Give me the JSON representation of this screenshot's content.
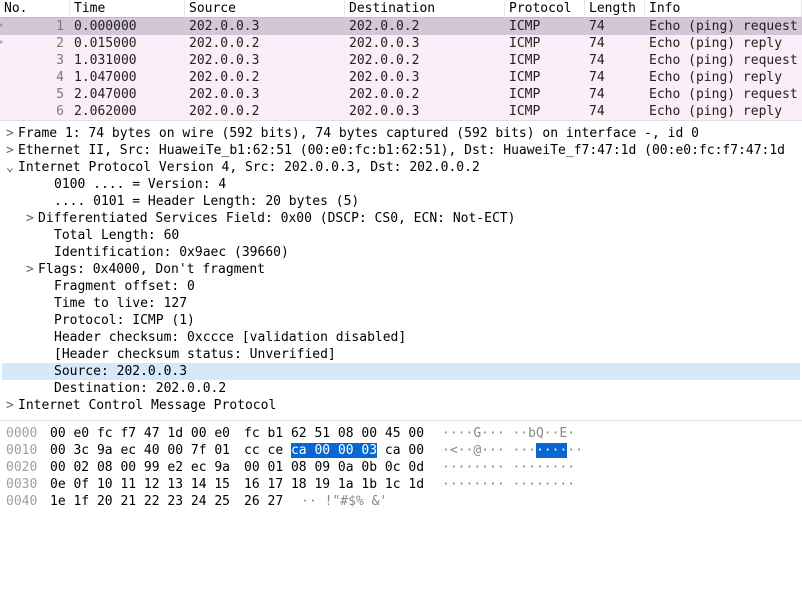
{
  "columns": [
    "No.",
    "Time",
    "Source",
    "Destination",
    "Protocol",
    "Length",
    "Info"
  ],
  "packets": [
    {
      "no": "1",
      "time": "0.000000",
      "src": "202.0.0.3",
      "dst": "202.0.0.2",
      "proto": "ICMP",
      "len": "74",
      "info": "Echo (ping) request",
      "sel": true,
      "mark": true
    },
    {
      "no": "2",
      "time": "0.015000",
      "src": "202.0.0.2",
      "dst": "202.0.0.3",
      "proto": "ICMP",
      "len": "74",
      "info": "Echo (ping) reply",
      "mark": true
    },
    {
      "no": "3",
      "time": "1.031000",
      "src": "202.0.0.3",
      "dst": "202.0.0.2",
      "proto": "ICMP",
      "len": "74",
      "info": "Echo (ping) request"
    },
    {
      "no": "4",
      "time": "1.047000",
      "src": "202.0.0.2",
      "dst": "202.0.0.3",
      "proto": "ICMP",
      "len": "74",
      "info": "Echo (ping) reply"
    },
    {
      "no": "5",
      "time": "2.047000",
      "src": "202.0.0.3",
      "dst": "202.0.0.2",
      "proto": "ICMP",
      "len": "74",
      "info": "Echo (ping) request"
    },
    {
      "no": "6",
      "time": "2.062000",
      "src": "202.0.0.2",
      "dst": "202.0.0.3",
      "proto": "ICMP",
      "len": "74",
      "info": "Echo (ping) reply"
    }
  ],
  "details": [
    {
      "lvl": 0,
      "caret": ">",
      "txt": "Frame 1: 74 bytes on wire (592 bits), 74 bytes captured (592 bits) on interface -, id 0"
    },
    {
      "lvl": 0,
      "caret": ">",
      "txt": "Ethernet II, Src: HuaweiTe_b1:62:51 (00:e0:fc:b1:62:51), Dst: HuaweiTe_f7:47:1d (00:e0:fc:f7:47:1d"
    },
    {
      "lvl": 0,
      "caret": "v",
      "txt": "Internet Protocol Version 4, Src: 202.0.0.3, Dst: 202.0.0.2"
    },
    {
      "lvl": 2,
      "caret": "",
      "txt": "0100 .... = Version: 4"
    },
    {
      "lvl": 2,
      "caret": "",
      "txt": ".... 0101 = Header Length: 20 bytes (5)"
    },
    {
      "lvl": 1,
      "caret": ">",
      "txt": "Differentiated Services Field: 0x00 (DSCP: CS0, ECN: Not-ECT)"
    },
    {
      "lvl": 2,
      "caret": "",
      "txt": "Total Length: 60"
    },
    {
      "lvl": 2,
      "caret": "",
      "txt": "Identification: 0x9aec (39660)"
    },
    {
      "lvl": 1,
      "caret": ">",
      "txt": "Flags: 0x4000, Don't fragment"
    },
    {
      "lvl": 2,
      "caret": "",
      "txt": "Fragment offset: 0"
    },
    {
      "lvl": 2,
      "caret": "",
      "txt": "Time to live: 127"
    },
    {
      "lvl": 2,
      "caret": "",
      "txt": "Protocol: ICMP (1)"
    },
    {
      "lvl": 2,
      "caret": "",
      "txt": "Header checksum: 0xccce [validation disabled]"
    },
    {
      "lvl": 2,
      "caret": "",
      "txt": "[Header checksum status: Unverified]"
    },
    {
      "lvl": 2,
      "caret": "",
      "txt": "Source: 202.0.0.3",
      "hl": true
    },
    {
      "lvl": 2,
      "caret": "",
      "txt": "Destination: 202.0.0.2"
    },
    {
      "lvl": 0,
      "caret": ">",
      "txt": "Internet Control Message Protocol"
    }
  ],
  "hex": [
    {
      "off": "0000",
      "b1": "00 e0 fc f7 47 1d 00 e0",
      "b2": "fc b1 62 51 08 00 45 00",
      "asc": "····G··· ··bQ··E·"
    },
    {
      "off": "0010",
      "b1": "00 3c 9a ec 40 00 7f 01",
      "b2pre": "cc ce ",
      "b2sel": "ca 00 00 03",
      "b2post": " ca 00",
      "asc": "·<··@··· ···",
      "ascsel": "····",
      "ascpost": "··"
    },
    {
      "off": "0020",
      "b1": "00 02 08 00 99 e2 ec 9a",
      "b2": "00 01 08 09 0a 0b 0c 0d",
      "asc": "········ ········"
    },
    {
      "off": "0030",
      "b1": "0e 0f 10 11 12 13 14 15",
      "b2": "16 17 18 19 1a 1b 1c 1d",
      "asc": "········ ········"
    },
    {
      "off": "0040",
      "b1": "1e 1f 20 21 22 23 24 25",
      "b2": "26 27",
      "asc": "·· !\"#$% &'"
    }
  ]
}
